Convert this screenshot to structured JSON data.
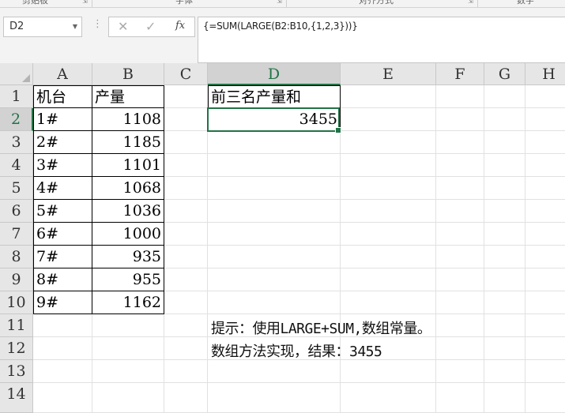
{
  "ribbon": {
    "groups": [
      "剪贴板",
      "字体",
      "对齐方式",
      "数字"
    ]
  },
  "namebox": {
    "value": "D2"
  },
  "formula_bar": {
    "cancel_icon": "close-icon",
    "enter_icon": "check-icon",
    "fx_label": "fx",
    "formula": "{=SUM(LARGE(B2:B10,{1,2,3}))}"
  },
  "columns": [
    "A",
    "B",
    "C",
    "D",
    "E",
    "F",
    "G",
    "H"
  ],
  "rows": [
    "1",
    "2",
    "3",
    "4",
    "5",
    "6",
    "7",
    "8",
    "9",
    "10",
    "11",
    "12",
    "13",
    "14"
  ],
  "table": {
    "header_a": "机台",
    "header_b": "产量",
    "machines": [
      "1#",
      "2#",
      "3#",
      "4#",
      "5#",
      "6#",
      "7#",
      "8#",
      "9#"
    ],
    "outputs": [
      "1108",
      "1185",
      "1101",
      "1068",
      "1036",
      "1000",
      "935",
      "955",
      "1162"
    ]
  },
  "result": {
    "label": "前三名产量和",
    "value": "3455"
  },
  "notes": {
    "line1": "提示：使用LARGE+SUM,数组常量。",
    "line2": "数组方法实现，结果：3455"
  },
  "colors": {
    "accent": "#217346",
    "header_bg": "#e6e6e6",
    "grid_line": "#e1e1e1"
  }
}
